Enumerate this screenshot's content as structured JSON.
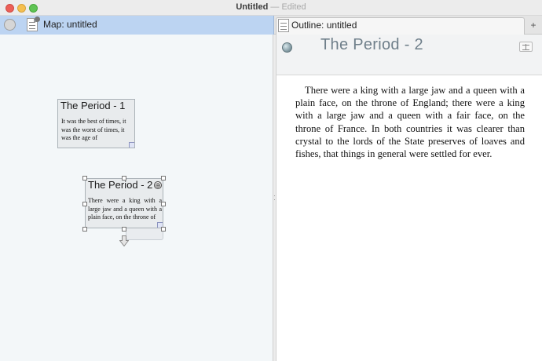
{
  "window": {
    "title": "Untitled",
    "separator": "—",
    "status": "Edited"
  },
  "tabs": {
    "left_label": "Map: untitled",
    "right_label": "Outline: untitled",
    "add_label": "+"
  },
  "map": {
    "cards": [
      {
        "title": "The Period - 1",
        "body": "It was the best of times, it was the worst of times, it was the age of"
      },
      {
        "title": "The Period - 2",
        "body": "There were a king with a large jaw and a queen with a plain face, on the throne of"
      }
    ],
    "expand_symbol": "⊕"
  },
  "outline": {
    "title": "The Period - 2",
    "body": "There were a king with a large jaw and a queen with a plain face, on the throne of England; there were a king with a large jaw and a queen with a fair face, on the throne of France. In both countries it was clearer than crystal to the lords of the State preserves of loaves and fishes, that things in general were settled for ever."
  },
  "colors": {
    "tab_active": "#bcd4f2",
    "map_background": "#f3f7f9",
    "card_background": "#e8ebed",
    "outline_title": "#6f7f8a"
  }
}
